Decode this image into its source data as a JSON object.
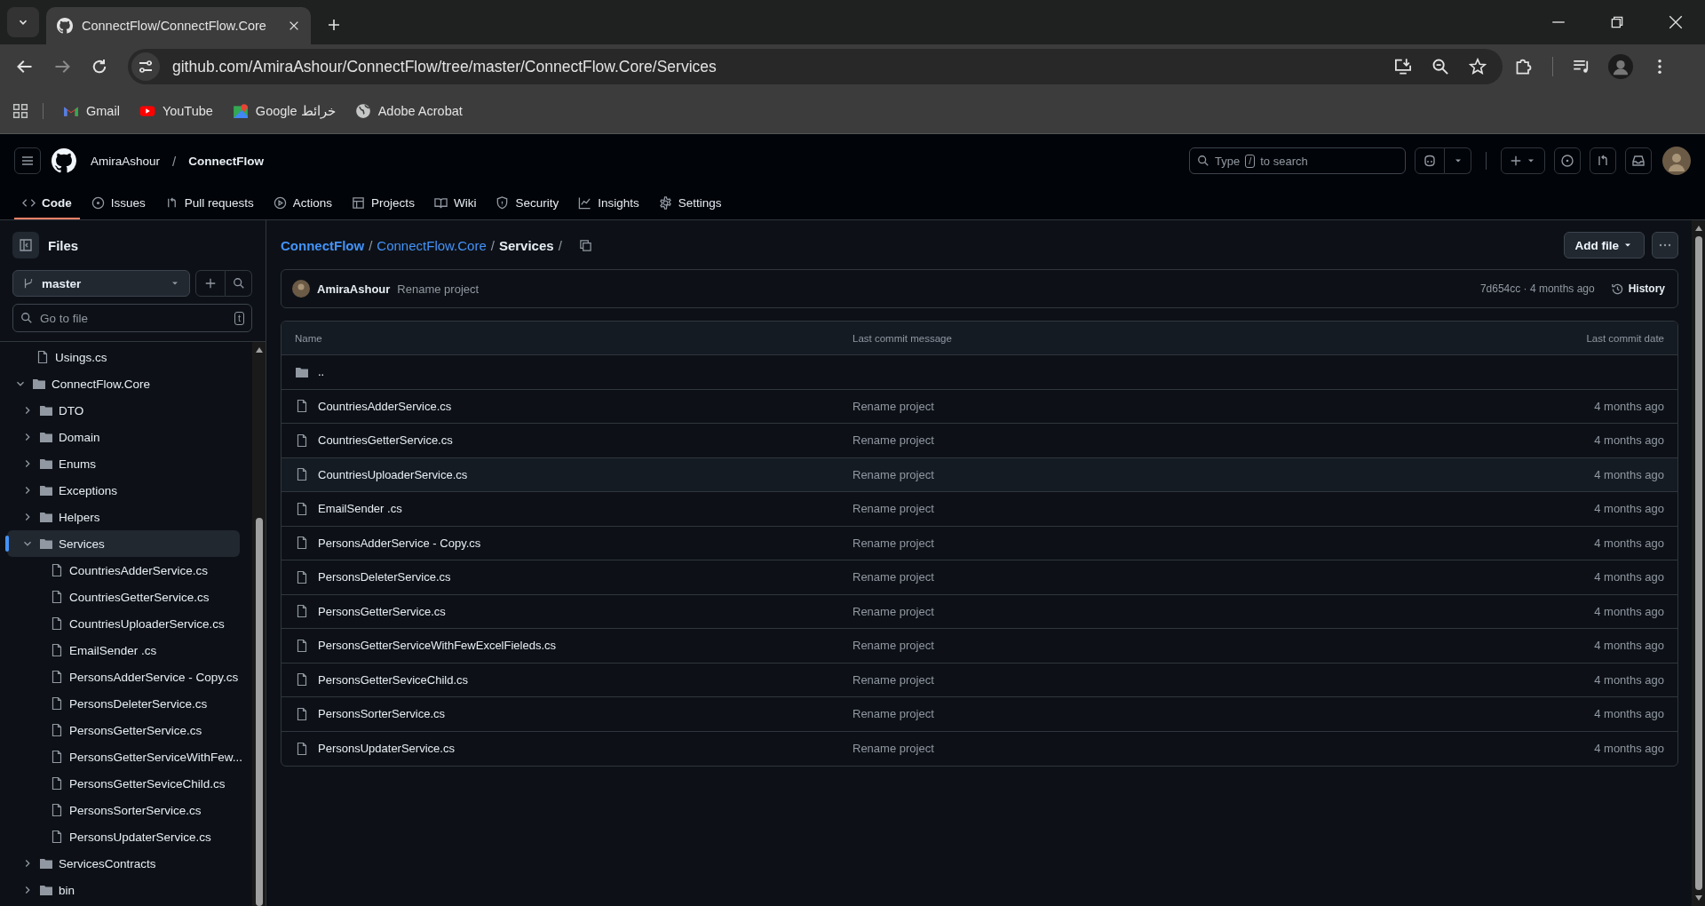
{
  "browser": {
    "tab_title": "ConnectFlow/ConnectFlow.Core",
    "url": "github.com/AmiraAshour/ConnectFlow/tree/master/ConnectFlow.Core/Services",
    "bookmarks": [
      {
        "kind": "gmail",
        "label": "Gmail"
      },
      {
        "kind": "youtube",
        "label": "YouTube"
      },
      {
        "kind": "maps",
        "label": "Google خرائط"
      },
      {
        "kind": "globe",
        "label": "Adobe Acrobat"
      }
    ]
  },
  "header": {
    "owner": "AmiraAshour",
    "separator": "/",
    "repo": "ConnectFlow",
    "search_placeholder": "Type",
    "search_key": "/",
    "search_suffix": "to search"
  },
  "nav_tabs": [
    {
      "kind": "code",
      "label": "Code",
      "selected": true
    },
    {
      "kind": "issues",
      "label": "Issues",
      "selected": false
    },
    {
      "kind": "pulls",
      "label": "Pull requests",
      "selected": false
    },
    {
      "kind": "actions",
      "label": "Actions",
      "selected": false
    },
    {
      "kind": "projects",
      "label": "Projects",
      "selected": false
    },
    {
      "kind": "wiki",
      "label": "Wiki",
      "selected": false
    },
    {
      "kind": "security",
      "label": "Security",
      "selected": false
    },
    {
      "kind": "insights",
      "label": "Insights",
      "selected": false
    },
    {
      "kind": "settings",
      "label": "Settings",
      "selected": false
    }
  ],
  "sidebar": {
    "title": "Files",
    "branch": "master",
    "filter_placeholder": "Go to file",
    "filter_key": "t",
    "tree": [
      {
        "kind": "file",
        "label": "Usings.cs",
        "selected": false
      },
      {
        "kind": "folder",
        "label": "ConnectFlow.Core",
        "expanded": true,
        "selected": false,
        "children": [
          {
            "kind": "folder",
            "label": "DTO",
            "expanded": false,
            "selected": false
          },
          {
            "kind": "folder",
            "label": "Domain",
            "expanded": false,
            "selected": false
          },
          {
            "kind": "folder",
            "label": "Enums",
            "expanded": false,
            "selected": false
          },
          {
            "kind": "folder",
            "label": "Exceptions",
            "expanded": false,
            "selected": false
          },
          {
            "kind": "folder",
            "label": "Helpers",
            "expanded": false,
            "selected": false
          },
          {
            "kind": "folder",
            "label": "Services",
            "expanded": true,
            "selected": true,
            "children": [
              {
                "kind": "file",
                "label": "CountriesAdderService.cs",
                "selected": false
              },
              {
                "kind": "file",
                "label": "CountriesGetterService.cs",
                "selected": false
              },
              {
                "kind": "file",
                "label": "CountriesUploaderService.cs",
                "selected": false
              },
              {
                "kind": "file",
                "label": "EmailSender .cs",
                "selected": false
              },
              {
                "kind": "file",
                "label": "PersonsAdderService - Copy.cs",
                "selected": false
              },
              {
                "kind": "file",
                "label": "PersonsDeleterService.cs",
                "selected": false
              },
              {
                "kind": "file",
                "label": "PersonsGetterService.cs",
                "selected": false
              },
              {
                "kind": "file",
                "label": "PersonsGetterServiceWithFew...",
                "selected": false
              },
              {
                "kind": "file",
                "label": "PersonsGetterSeviceChild.cs",
                "selected": false
              },
              {
                "kind": "file",
                "label": "PersonsSorterService.cs",
                "selected": false
              },
              {
                "kind": "file",
                "label": "PersonsUpdaterService.cs",
                "selected": false
              }
            ]
          },
          {
            "kind": "folder",
            "label": "ServicesContracts",
            "expanded": false,
            "selected": false
          },
          {
            "kind": "folder",
            "label": "bin",
            "expanded": false,
            "selected": false
          }
        ]
      }
    ]
  },
  "breadcrumb": [
    {
      "label": "ConnectFlow",
      "kind": "repo"
    },
    {
      "label": "/",
      "kind": "sep"
    },
    {
      "label": "ConnectFlow.Core",
      "kind": "link"
    },
    {
      "label": "/",
      "kind": "sep"
    },
    {
      "label": "Services",
      "kind": "current"
    },
    {
      "label": "/",
      "kind": "sep"
    }
  ],
  "add_file": "Add file",
  "commit": {
    "author": "AmiraAshour",
    "message": "Rename project",
    "sha_time": "7d654cc · 4 months ago",
    "history": "History"
  },
  "table": {
    "columns": [
      "Name",
      "Last commit message",
      "Last commit date"
    ],
    "rows": [
      {
        "kind": "parent",
        "name": ".."
      },
      {
        "kind": "file",
        "name": "CountriesAdderService.cs",
        "message": "Rename project",
        "date": "4 months ago",
        "hovered": false
      },
      {
        "kind": "file",
        "name": "CountriesGetterService.cs",
        "message": "Rename project",
        "date": "4 months ago",
        "hovered": false
      },
      {
        "kind": "file",
        "name": "CountriesUploaderService.cs",
        "message": "Rename project",
        "date": "4 months ago",
        "hovered": true
      },
      {
        "kind": "file",
        "name": "EmailSender .cs",
        "message": "Rename project",
        "date": "4 months ago",
        "hovered": false
      },
      {
        "kind": "file",
        "name": "PersonsAdderService - Copy.cs",
        "message": "Rename project",
        "date": "4 months ago",
        "hovered": false
      },
      {
        "kind": "file",
        "name": "PersonsDeleterService.cs",
        "message": "Rename project",
        "date": "4 months ago",
        "hovered": false
      },
      {
        "kind": "file",
        "name": "PersonsGetterService.cs",
        "message": "Rename project",
        "date": "4 months ago",
        "hovered": false
      },
      {
        "kind": "file",
        "name": "PersonsGetterServiceWithFewExcelFieleds.cs",
        "message": "Rename project",
        "date": "4 months ago",
        "hovered": false
      },
      {
        "kind": "file",
        "name": "PersonsGetterSeviceChild.cs",
        "message": "Rename project",
        "date": "4 months ago",
        "hovered": false
      },
      {
        "kind": "file",
        "name": "PersonsSorterService.cs",
        "message": "Rename project",
        "date": "4 months ago",
        "hovered": false
      },
      {
        "kind": "file",
        "name": "PersonsUpdaterService.cs",
        "message": "Rename project",
        "date": "4 months ago",
        "hovered": false
      }
    ]
  }
}
